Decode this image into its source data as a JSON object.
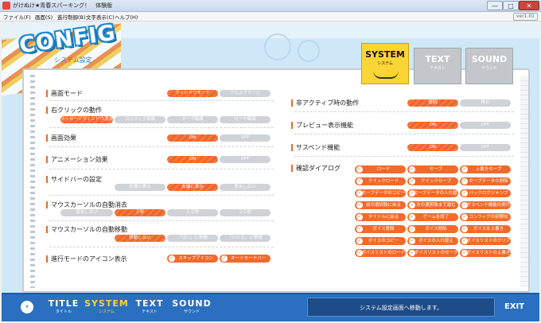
{
  "window": {
    "title": "がけぬけ★青春スパーキング！　体験版",
    "min_glyph": "—",
    "max_glyph": "□",
    "close_glyph": "✕",
    "version": "ver1.01"
  },
  "menu": [
    "ファイル(F)",
    "画面(S)",
    "進行制御(B)",
    "文字表示(C)",
    "ヘルプ(H)"
  ],
  "header": {
    "title": "CONFIG",
    "subtitle": "システム設定"
  },
  "tabs": [
    {
      "label": "SYSTEM",
      "sub": "システム",
      "active": true
    },
    {
      "label": "TEXT",
      "sub": "テキスト",
      "active": false
    },
    {
      "label": "SOUND",
      "sub": "サウンド",
      "active": false
    }
  ],
  "settings": {
    "screen_mode": {
      "label": "画面モード",
      "options": [
        "ウィンドウモード",
        "フルスクリーン"
      ],
      "selected": 0
    },
    "right_click": {
      "label": "右クリックの動作",
      "options": [
        "メッセージウィンドウ消去",
        "コンフィグ画面",
        "セーブ画面",
        "ロード画面"
      ],
      "selected": 0
    },
    "screen_effect": {
      "label": "画面効果",
      "options": [
        "ON",
        "OFF"
      ],
      "selected": 0
    },
    "animation": {
      "label": "アニメーション効果",
      "options": [
        "ON",
        "OFF"
      ],
      "selected": 0
    },
    "sidebar": {
      "label": "サイドバーの設定",
      "options": [
        "左端に表示",
        "右端に表示",
        "表示しない"
      ],
      "selected": 1
    },
    "cursor_hide": {
      "label": "マウスカーソルの自動消去",
      "options": [
        "消去しない",
        "５秒",
        "１０秒",
        "２０秒"
      ],
      "selected": 1
    },
    "cursor_move": {
      "label": "マウスカーソルの自動移動",
      "options": [
        "移動しない",
        "「はい」に移動",
        "「いいえ」に移動"
      ],
      "selected": 0
    },
    "progress_icon": {
      "label": "進行モードのアイコン表示",
      "options": [
        "スキップアイコン",
        "オートモードバー"
      ],
      "selected": [
        0,
        1
      ]
    },
    "inactive": {
      "label": "非アクティブ時の動作",
      "options": [
        "継続",
        "停止"
      ],
      "selected": 0
    },
    "preview": {
      "label": "プレビュー表示機能",
      "options": [
        "ON",
        "OFF"
      ],
      "selected": 0
    },
    "suspend": {
      "label": "サスペンド機能",
      "options": [
        "ON",
        "OFF"
      ],
      "selected": 0
    },
    "confirm": {
      "label": "確認ダイアログ",
      "items": [
        "ロード",
        "セーブ",
        "上書きセーブ",
        "クイックロード",
        "クイックセーブ",
        "セーブデータの削除",
        "セーブデータのコピー",
        "セーブデータの入れ替え",
        "バックログジャンプ",
        "前の選択肢に戻る",
        "次の選択肢まで進む",
        "サスペンド機能の実行",
        "タイトルに戻る",
        "ゲームを終了",
        "コンフィグの初期化",
        "ボイス登録",
        "ボイス削除",
        "ボイスを上書き",
        "ボイスのコピー",
        "ボイスの入れ替え",
        "ボイスリストのクリア",
        "ボイスリストのロード",
        "ボイスリストのセーブ",
        "ボイスリストの上書き"
      ]
    }
  },
  "bottom": {
    "back_glyph": "‹",
    "nav": [
      {
        "label": "TITLE",
        "sub": "タイトル",
        "active": false
      },
      {
        "label": "SYSTEM",
        "sub": "システム",
        "active": true
      },
      {
        "label": "TEXT",
        "sub": "テキスト",
        "active": false
      },
      {
        "label": "SOUND",
        "sub": "サウンド",
        "active": false
      }
    ],
    "message": "システム設定画面へ移動します。",
    "exit": "EXIT"
  },
  "colors": {
    "accent": "#f0642a",
    "brand_blue": "#2a6fc0",
    "highlight": "#fbd535",
    "inactive": "#cfd3d8"
  }
}
